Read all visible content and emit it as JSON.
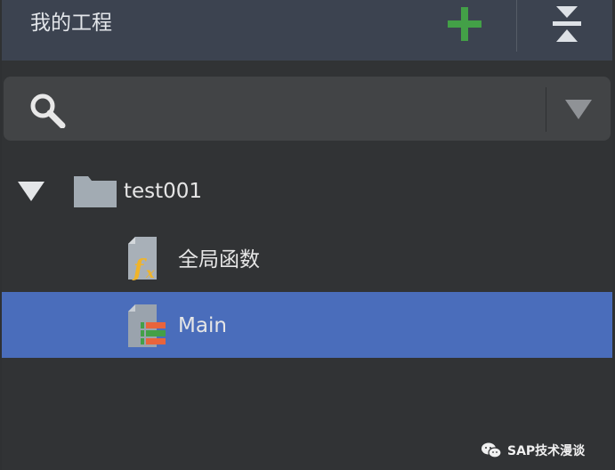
{
  "header": {
    "title": "我的工程",
    "accent_add": "#43a047"
  },
  "search": {
    "value": "",
    "placeholder": ""
  },
  "tree": {
    "project": {
      "name": "test001",
      "expanded": true
    },
    "items": [
      {
        "label": "全局函数",
        "icon": "function-file-icon",
        "selected": false
      },
      {
        "label": "Main",
        "icon": "table-file-icon",
        "selected": true
      }
    ]
  },
  "colors": {
    "header_bg": "#3c4350",
    "panel_bg": "#313335",
    "selection": "#4a6dbb"
  },
  "watermark": {
    "text": "SAP技术漫谈"
  }
}
